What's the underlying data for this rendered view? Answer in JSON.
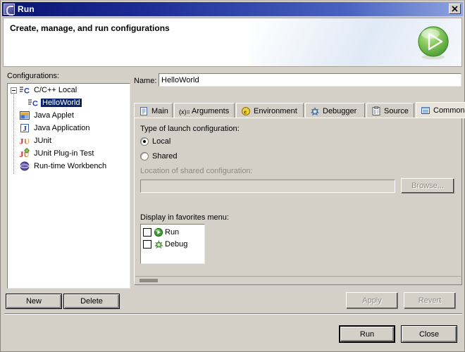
{
  "window": {
    "title": "Run",
    "icon": "eclipse-run-icon",
    "close_label": "✖"
  },
  "banner": {
    "title": "Create, manage, and run configurations",
    "icon": "run-large-icon"
  },
  "left": {
    "configurations_label": "Configurations:",
    "tree": [
      {
        "label": "C/C++ Local",
        "icon": "c-cpp-local-icon",
        "level": 0,
        "expanded": true,
        "selected": false
      },
      {
        "label": "HelloWorld",
        "icon": "c-cpp-config-icon",
        "level": 1,
        "expanded": null,
        "selected": true
      },
      {
        "label": "Java Applet",
        "icon": "java-applet-icon",
        "level": 0,
        "expanded": null,
        "selected": false
      },
      {
        "label": "Java Application",
        "icon": "java-application-icon",
        "level": 0,
        "expanded": null,
        "selected": false
      },
      {
        "label": "JUnit",
        "icon": "junit-icon",
        "level": 0,
        "expanded": null,
        "selected": false
      },
      {
        "label": "JUnit Plug-in Test",
        "icon": "junit-plugin-test-icon",
        "level": 0,
        "expanded": null,
        "selected": false
      },
      {
        "label": "Run-time Workbench",
        "icon": "runtime-workbench-icon",
        "level": 0,
        "expanded": null,
        "selected": false
      }
    ],
    "new_label": "New",
    "delete_label": "Delete"
  },
  "right": {
    "name_label": "Name:",
    "name_value": "HelloWorld",
    "tabs": [
      {
        "label": "Main",
        "icon": "document-icon",
        "active": false
      },
      {
        "label": "Arguments",
        "icon": "variable-icon",
        "active": false
      },
      {
        "label": "Environment",
        "icon": "environment-icon",
        "active": false
      },
      {
        "label": "Debugger",
        "icon": "bug-icon",
        "active": false
      },
      {
        "label": "Source",
        "icon": "source-icon",
        "active": false
      },
      {
        "label": "Common",
        "icon": "common-icon",
        "active": true
      }
    ],
    "common": {
      "type_label": "Type of launch configuration:",
      "local_label": "Local",
      "local_checked": true,
      "shared_label": "Shared",
      "shared_checked": false,
      "location_label": "Location of shared configuration:",
      "location_value": "",
      "browse_label": "Browse...",
      "favorites_label": "Display in favorites menu:",
      "favorites": [
        {
          "label": "Run",
          "icon": "run-icon",
          "checked": false
        },
        {
          "label": "Debug",
          "icon": "debug-icon",
          "checked": false
        }
      ]
    },
    "apply_label": "Apply",
    "revert_label": "Revert"
  },
  "footer": {
    "run_label": "Run",
    "close_label": "Close"
  },
  "colors": {
    "dialog_face": "#d4d0c8",
    "title_start": "#0a1570",
    "title_end": "#8fa4e0",
    "selection": "#0a246a",
    "accent_green": "#5fae3f"
  }
}
